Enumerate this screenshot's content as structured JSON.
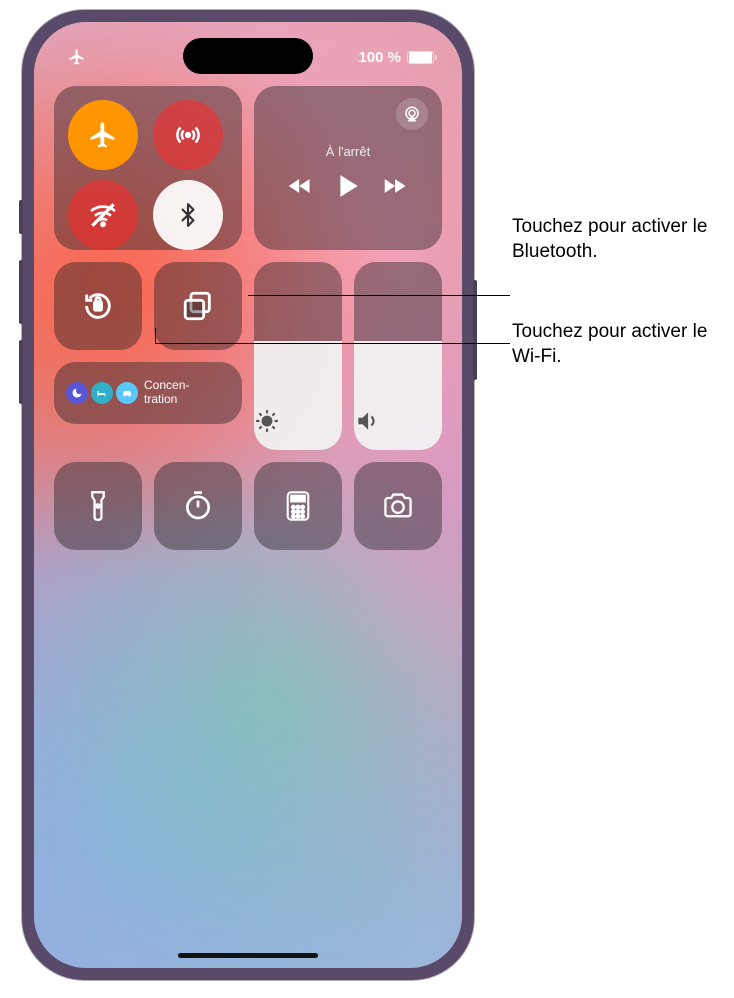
{
  "status": {
    "battery_text": "100 %"
  },
  "media": {
    "status_label": "À l'arrêt"
  },
  "focus": {
    "label": "Concen-\ntration"
  },
  "sliders": {
    "brightness_percent": 58,
    "volume_percent": 58
  },
  "callouts": {
    "bluetooth": "Touchez pour activer le Bluetooth.",
    "wifi": "Touchez pour activer le Wi-Fi."
  }
}
